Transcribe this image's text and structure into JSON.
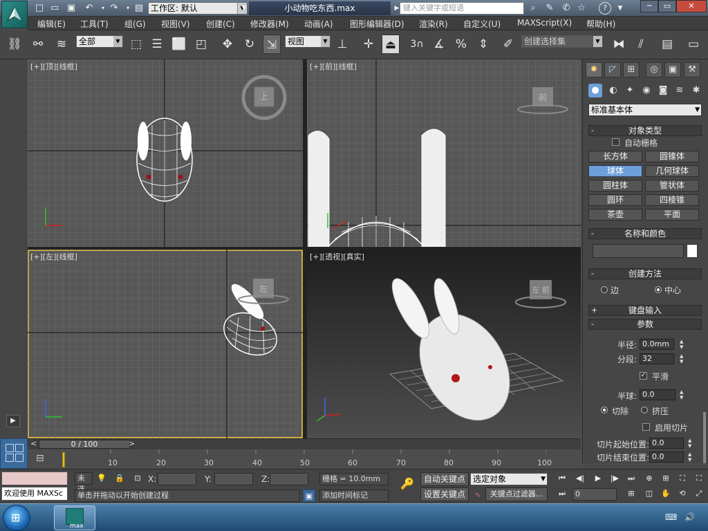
{
  "title_bar": {
    "workspace_label": "工作区: 默认",
    "document_name": "小动物吃东西.max",
    "search_placeholder": "键入关键字或短语"
  },
  "menu_bar": {
    "items": [
      "编辑(E)",
      "工具(T)",
      "组(G)",
      "视图(V)",
      "创建(C)",
      "修改器(M)",
      "动画(A)",
      "图形编辑器(D)",
      "渲染(R)",
      "自定义(U)",
      "MAXScript(X)",
      "帮助(H)"
    ]
  },
  "main_toolbar": {
    "selection_filter": "全部",
    "reference_coord": "视图",
    "snap_angle_label": "3",
    "named_selection_placeholder": "创建选择集"
  },
  "viewports": {
    "top": {
      "label": "[+][顶][线框]",
      "cube_label": "上"
    },
    "front": {
      "label": "[+][前][线框]",
      "cube_label": "前"
    },
    "left": {
      "label": "[+][左][线框]",
      "cube_label": "左"
    },
    "perspective": {
      "label": "[+][透视][真实]",
      "cube_label": "左 前"
    }
  },
  "command_panel": {
    "category_dropdown": "标准基本体",
    "object_type": {
      "header": "对象类型",
      "autogrid_label": "自动栅格",
      "buttons": [
        "长方体",
        "圆锥体",
        "球体",
        "几何球体",
        "圆柱体",
        "管状体",
        "圆环",
        "四棱锥",
        "茶壶",
        "平面"
      ],
      "active_button": "球体"
    },
    "name_color": {
      "header": "名称和颜色",
      "name_value": ""
    },
    "creation_method": {
      "header": "创建方法",
      "options": [
        "边",
        "中心"
      ],
      "selected": "中心"
    },
    "keyboard_entry": {
      "header": "键盘输入"
    },
    "parameters": {
      "header": "参数",
      "radius_label": "半径:",
      "radius_value": "0.0mm",
      "segments_label": "分段:",
      "segments_value": "32",
      "smooth_label": "平滑",
      "hemisphere_label": "半球:",
      "hemisphere_value": "0.0",
      "chop_label": "切除",
      "squash_label": "挤压",
      "slice_on_label": "启用切片",
      "slice_from_label": "切片起始位置:",
      "slice_from_value": "0.0",
      "slice_to_label": "切片结束位置:",
      "slice_to_value": "0.0"
    }
  },
  "timeline": {
    "frame_counter": "0 / 100",
    "ticks": [
      "10",
      "20",
      "30",
      "40",
      "50",
      "60",
      "70",
      "80",
      "90",
      "100"
    ]
  },
  "status_bar": {
    "maxscript_listener": "欢迎使用 MAXSc",
    "selection_status": "未选",
    "x_label": "X:",
    "y_label": "Y:",
    "z_label": "Z:",
    "grid_label": "栅格 = 10.0mm",
    "prompt": "单击并拖动以开始创建过程",
    "add_time_tag": "添加时间标记",
    "auto_key": "自动关键点",
    "set_key": "设置关键点",
    "key_mode_select": "选定对象",
    "key_filters": "关键点过滤器...",
    "current_frame": "0"
  },
  "taskbar": {
    "app_label": "max"
  }
}
